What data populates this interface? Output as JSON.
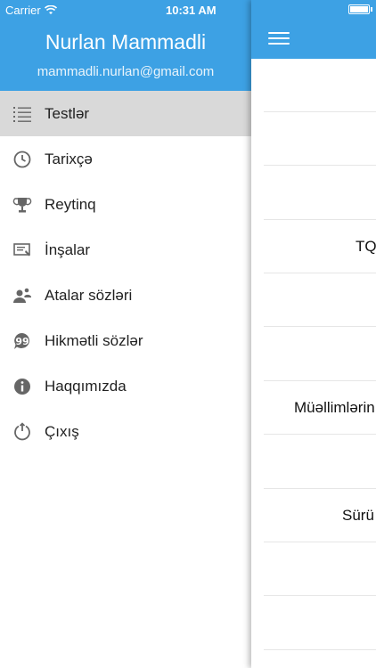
{
  "status_bar": {
    "carrier": "Carrier",
    "time": "10:31 AM"
  },
  "drawer": {
    "header_color": "#3da1e4",
    "user_name": "Nurlan Mammadli",
    "user_email": "mammadli.nurlan@gmail.com",
    "items": [
      {
        "label": "Testlər",
        "icon": "list-icon",
        "selected": true
      },
      {
        "label": "Tarixçə",
        "icon": "clock-icon",
        "selected": false
      },
      {
        "label": "Reytinq",
        "icon": "trophy-icon",
        "selected": false
      },
      {
        "label": "İnşalar",
        "icon": "essay-icon",
        "selected": false
      },
      {
        "label": "Atalar sözləri",
        "icon": "people-icon",
        "selected": false
      },
      {
        "label": "Hikmətli sözlər",
        "icon": "quote-icon",
        "selected": false
      },
      {
        "label": "Haqqımızda",
        "icon": "info-icon",
        "selected": false
      },
      {
        "label": "Çıxış",
        "icon": "power-icon",
        "selected": false
      }
    ]
  },
  "main": {
    "menu_icon": "hamburger-icon",
    "rows": [
      {
        "label": ""
      },
      {
        "label": ""
      },
      {
        "label": ""
      },
      {
        "label": "TQ"
      },
      {
        "label": ""
      },
      {
        "label": ""
      },
      {
        "label": "Müəllimlərin"
      },
      {
        "label": ""
      },
      {
        "label": "Sürü"
      },
      {
        "label": ""
      },
      {
        "label": ""
      }
    ]
  }
}
